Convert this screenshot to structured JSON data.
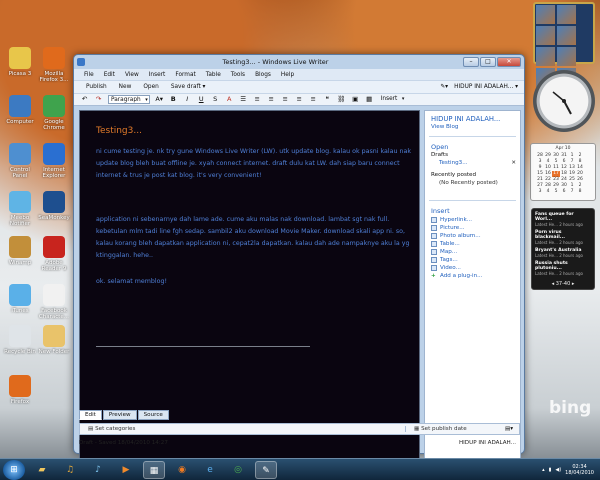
{
  "desktop": {
    "icons": [
      {
        "label": "Picasa 3",
        "color": "#e8c64a"
      },
      {
        "label": "Mozilla Firefox 3...",
        "color": "#e06a1c"
      },
      {
        "label": "Computer",
        "color": "#3c7ac2"
      },
      {
        "label": "Google Chrome",
        "color": "#3fa34d"
      },
      {
        "label": "Control Panel",
        "color": "#4e8fd0"
      },
      {
        "label": "Internet Explorer",
        "color": "#2a6fd1"
      },
      {
        "label": "Meebo Notifier",
        "color": "#5fb4e5"
      },
      {
        "label": "SeaMonkey",
        "color": "#1e4f8f"
      },
      {
        "label": "Winamp",
        "color": "#c28f3a"
      },
      {
        "label": "Adobe Reader 9",
        "color": "#c8241e"
      },
      {
        "label": "iTunes",
        "color": "#5ab0e8"
      },
      {
        "label": "Facebook Characte...",
        "color": "#f1f1f1"
      },
      {
        "label": "Recycle Bin",
        "color": "#dfe4e8"
      },
      {
        "label": "New Folder",
        "color": "#e9c36a"
      },
      {
        "label": "Firefox",
        "color": "#e06a1c"
      }
    ],
    "recycle_bin_label": "Recycle Bin",
    "bing_logo": "bing"
  },
  "window": {
    "title": "Testing3... - Windows Live Writer",
    "menu": [
      "File",
      "Edit",
      "View",
      "Insert",
      "Format",
      "Table",
      "Tools",
      "Blogs",
      "Help"
    ],
    "toolbar": [
      "Publish",
      "New",
      "Open",
      "Save draft"
    ],
    "blog_name": "HIDUP INI ADALAH...",
    "format": {
      "paragraph": "Paragraph",
      "bold": "B",
      "italic": "I",
      "underline": "U",
      "insert": "Insert"
    }
  },
  "editor": {
    "title": "Testing3...",
    "p1": "ni cume testing je. nk try gune Windows Live Writer (LW). utk update blog. kalau ok pasni kalau nak update blog bleh buat offline je. xyah connect internet. draft dulu kat LW. dah siap baru connect internet & trus je post kat blog. it's very convenient!",
    "p2": "application ni sebenarnye dah lame ade. cume aku malas nak download. lambat sgt nak full. kebetulan mlm tadi line fgh sedap. sambil2 aku download Movie Maker. download skali app ni. so, kalau korang bleh dapatkan application ni, cepat2la dapatkan. kalau dah ade nampaknye aku la yg ktinggalan. hehe..",
    "p3": "ok. selamat memblog!"
  },
  "sidebar": {
    "blog_title": "HIDUP INI ADALAH...",
    "view_blog": "View Blog",
    "open": "Open",
    "drafts": "Drafts",
    "draft_item": "Testing3...",
    "recently_posted": "Recently posted",
    "no_recent": "(No Recently posted)",
    "insert": "Insert",
    "insert_items": [
      "Hyperlink...",
      "Picture...",
      "Photo album...",
      "Table...",
      "Map...",
      "Tags...",
      "Video...",
      "Add a plug-in..."
    ]
  },
  "view_tabs": [
    "Edit",
    "Preview",
    "Source"
  ],
  "bottom": {
    "categories": "Set categories",
    "publish_date": "Set publish date",
    "status": "Draft - Saved 18/04/2010 14:27",
    "status_blog": "HIDUP INI ADALAH..."
  },
  "gadgets": {
    "calendar_month": "Apr 10",
    "calendar_days": [
      "28",
      "29",
      "30",
      "31",
      "1",
      "2",
      "3",
      "4",
      "5",
      "6",
      "7",
      "8",
      "9",
      "10",
      "11",
      "12",
      "13",
      "14",
      "15",
      "16",
      "17",
      "18",
      "19",
      "20",
      "21",
      "22",
      "23",
      "24",
      "25",
      "26",
      "27",
      "28",
      "29",
      "30",
      "1",
      "2",
      "3",
      "4",
      "5",
      "6",
      "7",
      "8"
    ],
    "feeds": [
      {
        "title": "Fans queue for Worl...",
        "sub": "Latest He... 2 hours ago"
      },
      {
        "title": "Porn virus blackmail...",
        "sub": "Latest He... 2 hours ago"
      },
      {
        "title": "Bryant's Australia",
        "sub": "Latest He... 2 hours ago"
      },
      {
        "title": "Russia shuts plutoniu...",
        "sub": "Latest He... 2 hours ago"
      }
    ],
    "feed_nav": "37-40"
  },
  "taskbar": {
    "time": "02:34",
    "date": "18/04/2010"
  }
}
